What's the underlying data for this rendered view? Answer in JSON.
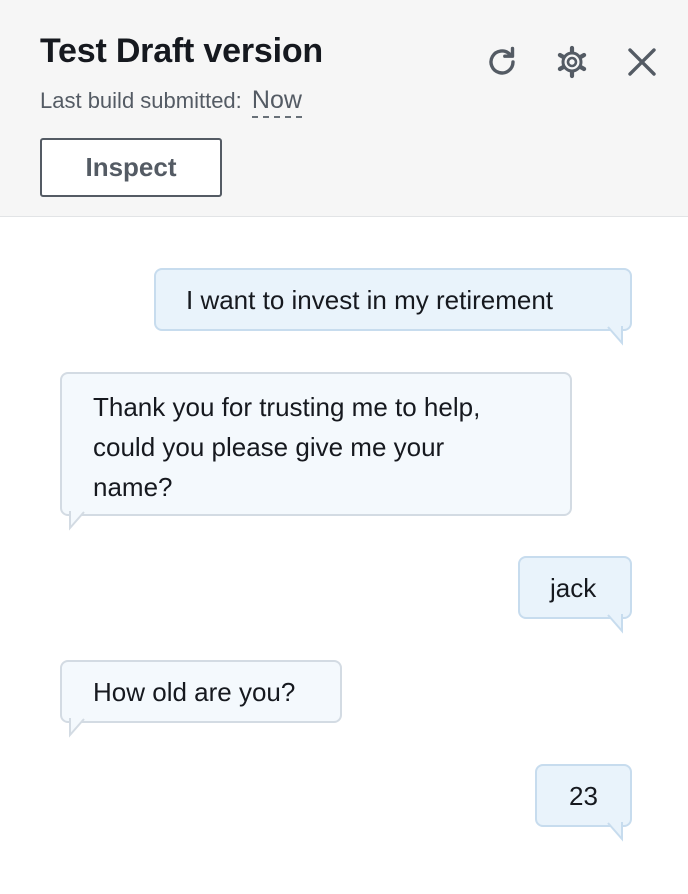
{
  "header": {
    "title": "Test Draft version",
    "subtitle_prefix": "Last build submitted:",
    "subtitle_value": "Now",
    "inspect_label": "Inspect",
    "icons": [
      "refresh-icon",
      "settings-icon",
      "close-icon"
    ]
  },
  "messages": [
    {
      "role": "user",
      "text": "I want to invest in my retirement"
    },
    {
      "role": "bot",
      "lines": [
        "Thank you for trusting me to help,",
        "could you please give me your",
        "name?"
      ]
    },
    {
      "role": "user",
      "text": "jack"
    },
    {
      "role": "bot",
      "text": "How old are you?"
    },
    {
      "role": "user",
      "text": "23"
    }
  ],
  "colors": {
    "header_bg": "#f6f6f6",
    "user_bubble": "#e9f3fb",
    "bot_bubble": "#f4f9fd",
    "text": "#16191f",
    "muted": "#545b64"
  }
}
